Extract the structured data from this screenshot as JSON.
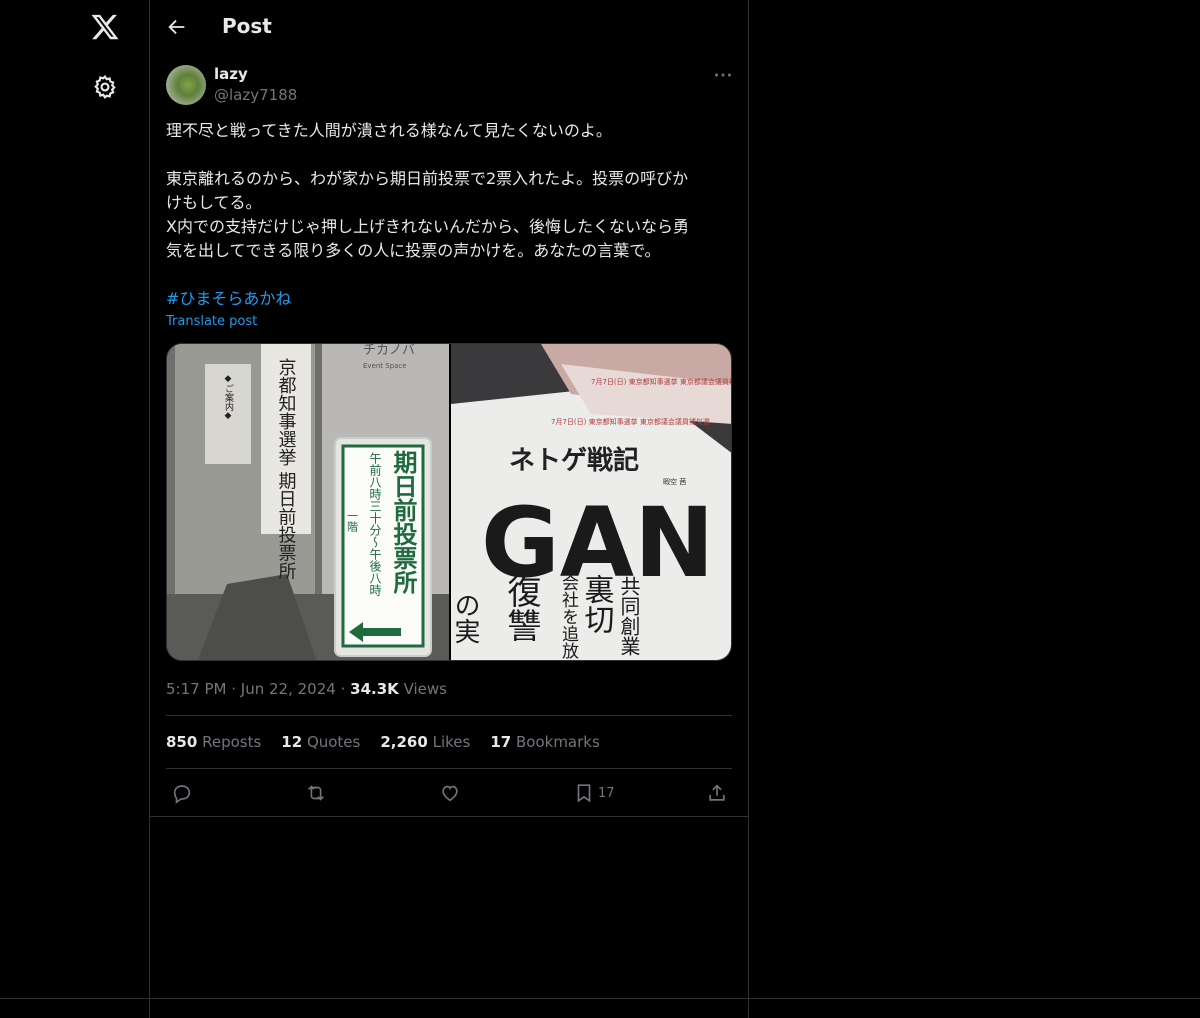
{
  "header": {
    "title": "Post"
  },
  "post": {
    "author_name": "lazy",
    "author_handle": "@lazy7188",
    "text": "理不尽と戦ってきた人間が潰される様なんて見たくないのよ。\n\n東京離れるのから、わが家から期日前投票で2票入れたよ。投票の呼びか\nけもしてる。\nX内での支持だけじゃ押し上げきれないんだから、後悔したくないなら勇\n気を出してできる限り多くの人に投票の声かけを。あなたの言葉で。",
    "hashtag": "#ひまそらあかね",
    "translate": "Translate post",
    "time": "5:17 PM",
    "date": "Jun 22, 2024",
    "views_count": "34.3K",
    "views_label": "Views",
    "sep": "·"
  },
  "stats": {
    "reposts_count": "850",
    "reposts_label": "Reposts",
    "quotes_count": "12",
    "quotes_label": "Quotes",
    "likes_count": "2,260",
    "likes_label": "Likes",
    "bookmarks_count": "17",
    "bookmarks_label": "Bookmarks"
  },
  "actions": {
    "bookmark_count": "17"
  },
  "media": {
    "left_sign_text": "期日前投票所",
    "left_sign_sub": "午前八時三十分～午後八時",
    "left_sign_floor": "一階",
    "left_poster_text": "京都知事選挙 期日前投票所",
    "left_notice": "◆ご案内◆",
    "left_room": "チカノバ",
    "left_room_sub": "Event Space",
    "right_title": "ネトゲ戦記",
    "right_author": "暇空 茜",
    "right_big": "GAN",
    "right_k1": "の実",
    "right_k2": "復讐",
    "right_k3": "会社を追放",
    "right_k4": "裏切",
    "right_k5": "共同創業",
    "right_flyer1": "7月7日(日) 東京都知事選挙 東京都議会議員補欠選",
    "right_flyer2": "7月7日(日) 東京都知事選挙 東京都議会議員補欠選"
  },
  "colors": {
    "background": "#000000",
    "text": "#e7e9ea",
    "muted": "#71767b",
    "accent": "#1d9bf0",
    "border": "#2f3336"
  },
  "icons": [
    "x-logo-icon",
    "gear-icon",
    "back-arrow-icon",
    "more-icon",
    "reply-icon",
    "repost-icon",
    "like-icon",
    "bookmark-icon",
    "share-icon"
  ]
}
